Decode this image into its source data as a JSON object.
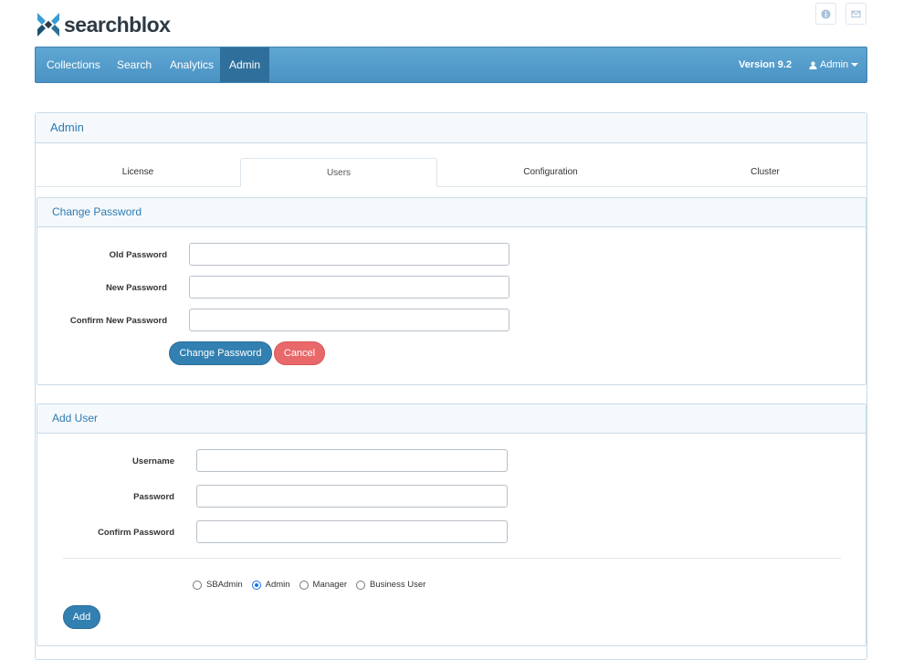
{
  "brand": {
    "name": "searchblox"
  },
  "top_icons": [
    {
      "icon": "info-icon"
    },
    {
      "icon": "mail-icon"
    }
  ],
  "navbar": {
    "items": [
      "Collections",
      "Search",
      "Analytics",
      "Admin"
    ],
    "active": "Admin",
    "version": "Version 9.2",
    "user": "Admin"
  },
  "panel": {
    "title": "Admin",
    "tabs": [
      "License",
      "Users",
      "Configuration",
      "Cluster"
    ],
    "active_tab": "Users"
  },
  "change_password": {
    "title": "Change Password",
    "old_label": "Old Password",
    "new_label": "New Password",
    "confirm_label": "Confirm New Password",
    "submit_label": "Change Password",
    "cancel_label": "Cancel"
  },
  "add_user": {
    "title": "Add User",
    "username_label": "Username",
    "password_label": "Password",
    "confirm_label": "Confirm Password",
    "roles": [
      "SBAdmin",
      "Admin",
      "Manager",
      "Business User"
    ],
    "selected_role": "Admin",
    "add_label": "Add"
  },
  "colors": {
    "accent": "#3280b1",
    "danger": "#e9686a",
    "nav": "#4a93c4"
  }
}
